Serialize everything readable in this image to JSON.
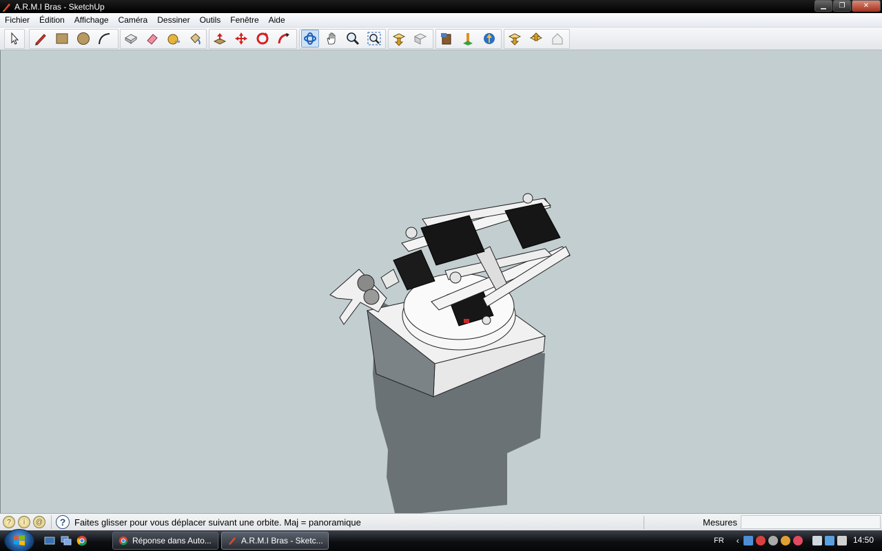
{
  "window": {
    "title": "A.R.M.I Bras - SketchUp"
  },
  "menu": [
    "Fichier",
    "Édition",
    "Affichage",
    "Caméra",
    "Dessiner",
    "Outils",
    "Fenêtre",
    "Aide"
  ],
  "toolbar": {
    "tools": [
      {
        "name": "select-tool-icon"
      },
      {
        "name": "pencil-tool-icon"
      },
      {
        "name": "rectangle-tool-icon"
      },
      {
        "name": "circle-tool-icon"
      },
      {
        "name": "arc-tool-icon"
      },
      {
        "name": "make-component-icon"
      },
      {
        "name": "eraser-tool-icon"
      },
      {
        "name": "tape-measure-icon"
      },
      {
        "name": "paint-bucket-icon"
      },
      {
        "name": "push-pull-icon"
      },
      {
        "name": "move-tool-icon"
      },
      {
        "name": "rotate-tool-icon"
      },
      {
        "name": "follow-me-icon"
      },
      {
        "name": "orbit-tool-icon"
      },
      {
        "name": "pan-tool-icon"
      },
      {
        "name": "zoom-tool-icon"
      },
      {
        "name": "zoom-extents-icon"
      },
      {
        "name": "get-models-icon"
      },
      {
        "name": "share-model-icon"
      },
      {
        "name": "get-photo-texture-icon"
      },
      {
        "name": "position-camera-icon"
      },
      {
        "name": "walk-icon"
      },
      {
        "name": "look-around-icon"
      },
      {
        "name": "section-plane-icon"
      },
      {
        "name": "display-sections-icon"
      },
      {
        "name": "warehouse-icon"
      }
    ],
    "active_tool": "orbit-tool-icon"
  },
  "status": {
    "hint": "Faites glisser pour vous déplacer suivant une orbite.  Maj = panoramique",
    "measure_label": "Mesures",
    "measure_value": ""
  },
  "taskbar": {
    "tasks": [
      {
        "label": "Réponse dans Auto...",
        "active": false
      },
      {
        "label": "A.R.M.I Bras - Sketc...",
        "active": true
      }
    ],
    "language": "FR",
    "clock": "14:50"
  },
  "colors": {
    "viewport_bg": "#c3ced0",
    "model_white": "#f2f2f2",
    "servo_black": "#151515",
    "shadow": "#6b7275"
  }
}
